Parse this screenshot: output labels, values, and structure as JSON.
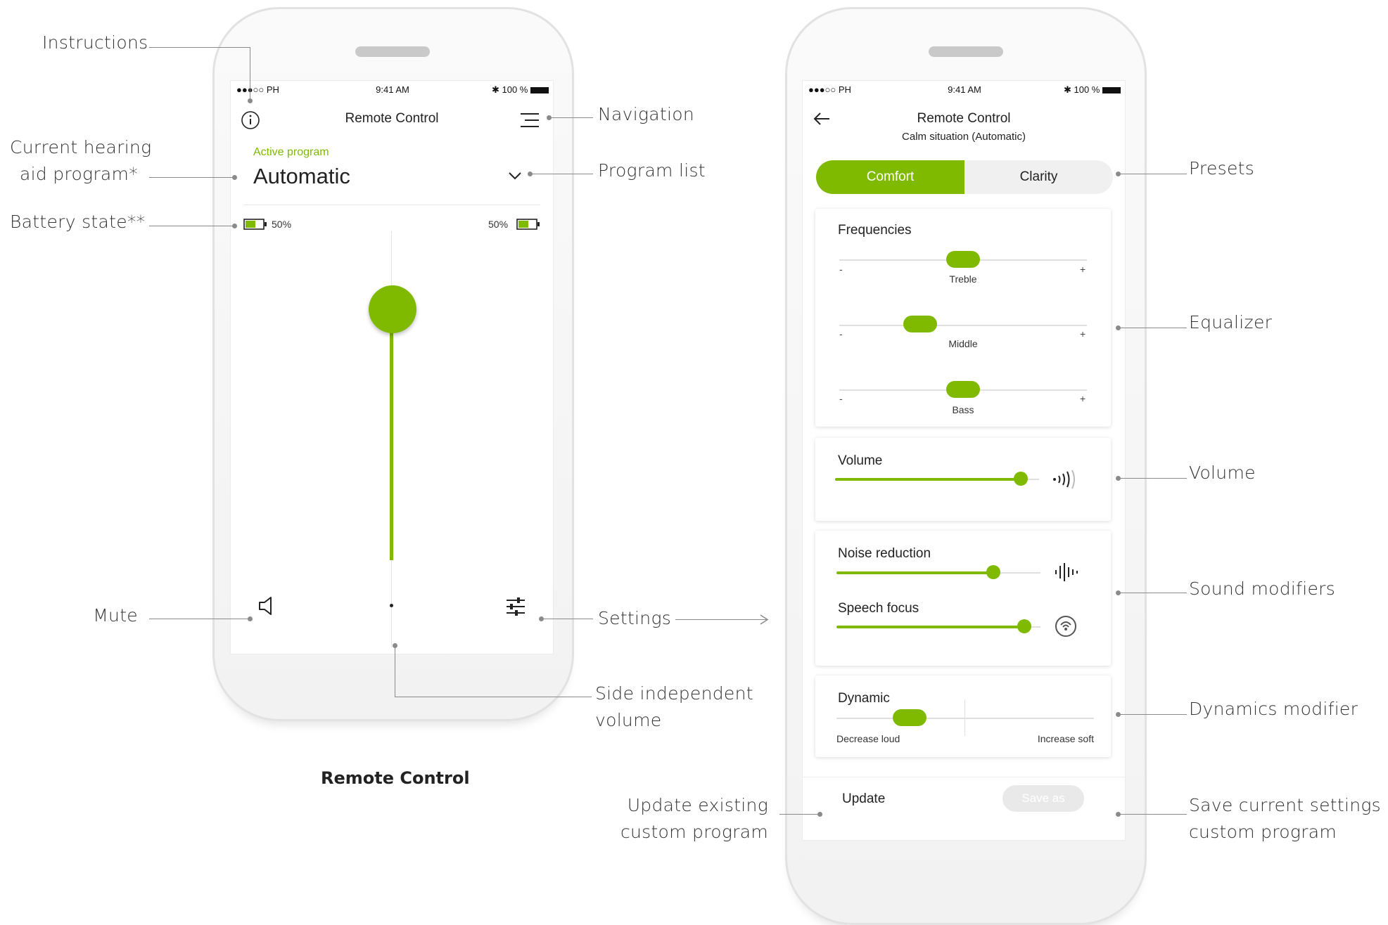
{
  "left_phone": {
    "status": {
      "carrier": "●●●○○ PH",
      "time": "9:41 AM",
      "battery": "100 %"
    },
    "title": "Remote Control",
    "active_program_label": "Active program",
    "program_name": "Automatic",
    "battery_left": "50%",
    "battery_right": "50%",
    "caption": "Remote Control"
  },
  "right_phone": {
    "status": {
      "carrier": "●●●○○ PH",
      "time": "9:41 AM",
      "battery": "100 %"
    },
    "title": "Remote Control",
    "subtitle": "Calm situation (Automatic)",
    "presets": [
      "Comfort",
      "Clarity"
    ],
    "equalizer": {
      "title": "Frequencies",
      "bands": [
        {
          "name": "Treble",
          "level": 0.5
        },
        {
          "name": "Middle",
          "level": 0.3
        },
        {
          "name": "Bass",
          "level": 0.5
        }
      ],
      "minus": "-",
      "plus": "+"
    },
    "volume": {
      "label": "Volume",
      "level": 0.91
    },
    "noise_reduction": {
      "label": "Noise reduction",
      "level": 0.77
    },
    "speech_focus": {
      "label": "Speech focus",
      "level": 0.92
    },
    "dynamic": {
      "label": "Dynamic",
      "left": "Decrease loud",
      "right": "Increase soft",
      "level": 0.25
    },
    "update_button": "Update",
    "save_button": "Save as"
  },
  "annotations": {
    "instructions": "Instructions",
    "current_program_1": "Current hearing",
    "current_program_2": "aid program*",
    "battery_state": "Battery state**",
    "mute": "Mute",
    "navigation": "Navigation",
    "program_list": "Program list",
    "settings": "Settings",
    "side_volume_1": "Side independent",
    "side_volume_2": "volume",
    "presets": "Presets",
    "equalizer": "Equalizer",
    "volume": "Volume",
    "sound_modifiers": "Sound modifiers",
    "dynamics_modifier": "Dynamics modifier",
    "update_existing_1": "Update existing",
    "update_existing_2": "custom program",
    "save_current_1": "Save current settings as",
    "save_current_2": "custom program"
  },
  "colors": {
    "accent": "#7fba00",
    "track": "#e0e0e0",
    "leader": "#8a8a8a"
  }
}
